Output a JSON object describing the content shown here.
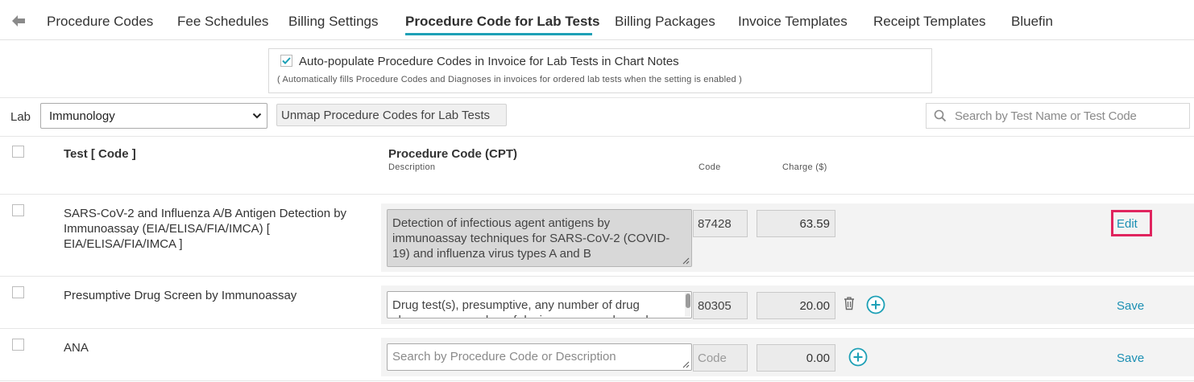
{
  "tabs": [
    {
      "label": "Procedure Codes",
      "active": false
    },
    {
      "label": "Fee Schedules",
      "active": false
    },
    {
      "label": "Billing Settings",
      "active": false
    },
    {
      "label": "Procedure Code for Lab Tests",
      "active": true
    },
    {
      "label": "Billing Packages",
      "active": false
    },
    {
      "label": "Invoice Templates",
      "active": false
    },
    {
      "label": "Receipt Templates",
      "active": false
    },
    {
      "label": "Bluefin",
      "active": false
    }
  ],
  "auto_populate": {
    "checked": true,
    "label": "Auto-populate Procedure Codes in Invoice for Lab Tests in Chart Notes",
    "note": "( Automatically fills Procedure Codes and Diagnoses in invoices for ordered lab tests when the setting is enabled )"
  },
  "filters": {
    "lab_label": "Lab",
    "lab_value": "Immunology",
    "unmap_label": "Unmap Procedure Codes for Lab Tests",
    "search_placeholder": "Search by Test Name or Test Code"
  },
  "table": {
    "col_test": "Test [ Code ]",
    "col_procedure": "Procedure Code (CPT)",
    "col_description": "Description",
    "col_code": "Code",
    "col_charge": "Charge ($)"
  },
  "rows": [
    {
      "test": "SARS-CoV-2 and Influenza A/B Antigen Detection by Immunoassay (EIA/ELISA/FIA/IMCA) [ EIA/ELISA/FIA/IMCA ]",
      "description": "Detection of infectious agent antigens by immunoassay techniques for SARS-CoV-2 (COVID-19) and influenza virus types A and B",
      "code": "87428",
      "charge": "63.59",
      "action": "Edit"
    },
    {
      "test": "Presumptive Drug Screen by Immunoassay",
      "description": "Drug test(s), presumptive, any number of drug classes, any number of devices or procedures; by instrument chemistry analyzers",
      "code": "80305",
      "charge": "20.00",
      "action": "Save"
    },
    {
      "test": "ANA",
      "description_placeholder": "Search by Procedure Code or Description",
      "code_placeholder": "Code",
      "charge": "0.00",
      "action": "Save"
    }
  ],
  "icons": {
    "back": "arrow-left-icon",
    "checkmark": "checkmark-icon",
    "chevron": "chevron-down-icon",
    "search": "search-icon",
    "trash": "trash-icon",
    "add": "plus-circle-icon"
  },
  "colors": {
    "accent": "#1da0b6",
    "link": "#1b8fb3",
    "highlight": "#e0245e"
  }
}
